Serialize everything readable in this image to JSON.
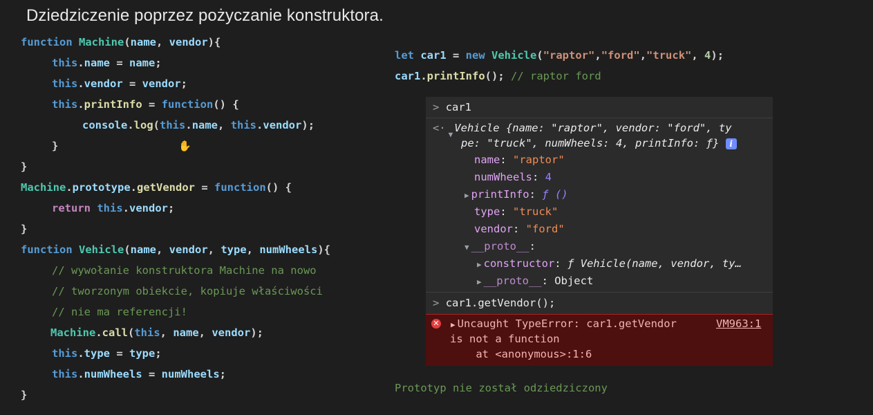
{
  "title": "Dziedziczenie poprzez pożyczanie konstruktora.",
  "left_code": {
    "l1": {
      "a": "function",
      "b": " ",
      "c": "Machine",
      "d": "(",
      "e": "name",
      ",": ", ",
      "f": "vendor",
      "g": "){"
    },
    "l2": {
      "a": "this",
      "b": ".",
      "c": "name",
      "d": " = ",
      "e": "name",
      "f": ";"
    },
    "l3": {
      "a": "this",
      "b": ".",
      "c": "vendor",
      "d": " = ",
      "e": "vendor",
      "f": ";"
    },
    "l4": {
      "a": "this",
      "b": ".",
      "c": "printInfo",
      "d": " = ",
      "e": "function",
      "f": "() {"
    },
    "l5": {
      "a": "console",
      "b": ".",
      "c": "log",
      "d": "(",
      "e": "this",
      "f": ".",
      "g": "name",
      "h": ", ",
      "i": "this",
      "j": ".",
      "k": "vendor",
      "l": ");"
    },
    "l6": "}",
    "l7": "}",
    "l8": {
      "a": "Machine",
      "b": ".",
      "c": "prototype",
      "d": ".",
      "e": "getVendor",
      "f": " = ",
      "g": "function",
      "h": "() {"
    },
    "l9": {
      "a": "return",
      "b": " ",
      "c": "this",
      "d": ".",
      "e": "vendor",
      "f": ";"
    },
    "l10": "}",
    "l11": {
      "a": "function",
      "b": " ",
      "c": "Vehicle",
      "d": "(",
      "e": "name",
      ",1": ", ",
      "f": "vendor",
      ",2": ", ",
      "g": "type",
      ",3": ", ",
      "h": "numWheels",
      "i": "){"
    },
    "l12": "// wywołanie konstruktora Machine na nowo",
    "l13": "// tworzonym obiekcie, kopiuje właściwości",
    "l14": "// nie ma referencji!",
    "l15": {
      "a": "Machine",
      "b": ".",
      "c": "call",
      "d": "(",
      "e": "this",
      ",1": ", ",
      "f": "name",
      ",2": ", ",
      "g": "vendor",
      "h": ");"
    },
    "l16": {
      "a": "this",
      "b": ".",
      "c": "type",
      "d": " = ",
      "e": "type",
      "f": ";"
    },
    "l17": {
      "a": "this",
      "b": ".",
      "c": "numWheels",
      "d": " = ",
      "e": "numWheels",
      "f": ";"
    },
    "l18": "}"
  },
  "right_code": {
    "r1": {
      "a": "let",
      "b": " ",
      "c": "car1",
      "d": " = ",
      "e": "new",
      "f": " ",
      "g": "Vehicle",
      "h": "(",
      "i": "\"raptor\"",
      "j": ",",
      "k": "\"ford\"",
      "l": ",",
      "m": "\"truck\"",
      "n": ", ",
      "o": "4",
      "p": ");"
    },
    "r2": {
      "a": "car1",
      "b": ".",
      "c": "printInfo",
      "d": "(); ",
      "e": "// raptor ford"
    }
  },
  "console": {
    "prompt1": "car1",
    "obj_head": "Vehicle {name: \"raptor\", vendor: \"ford\", ty",
    "obj_head2": "pe: \"truck\", numWheels: 4, printInfo: ƒ}",
    "name_k": "name",
    "name_v": "\"raptor\"",
    "wheels_k": "numWheels",
    "wheels_v": "4",
    "pinfo_k": "printInfo",
    "pinfo_v": "ƒ ()",
    "type_k": "type",
    "type_v": "\"truck\"",
    "vendor_k": "vendor",
    "vendor_v": "\"ford\"",
    "proto_k": "__proto__",
    "ctor_k": "constructor",
    "ctor_v": "ƒ Vehicle(name, vendor, ty…",
    "proto2_k": "__proto__",
    "proto2_v": "Object",
    "prompt2": "car1.getVendor();",
    "err1": "Uncaught TypeError: car1.getVendor",
    "err_link": "VM963:1",
    "err2": "is not a function",
    "err3": "    at <anonymous>:1:6"
  },
  "footer_note": "Prototyp nie został odziedziczony"
}
